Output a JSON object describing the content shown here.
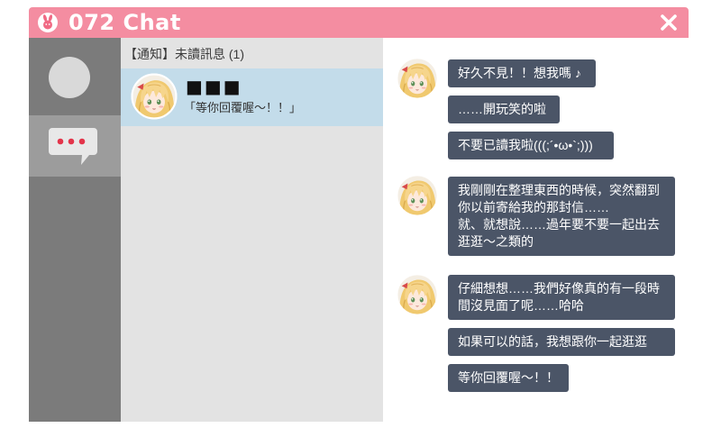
{
  "window": {
    "title": "072 Chat",
    "brand_color": "#f48da1",
    "logo_icon": "app-logo-icon",
    "close_icon": "close-icon"
  },
  "sidebar": {
    "items": [
      {
        "icon": "avatar-placeholder-icon",
        "active": false
      },
      {
        "icon": "chat-bubble-icon",
        "active": true
      }
    ]
  },
  "conversation_list": {
    "header": "【通知】未讀訊息 (1)",
    "items": [
      {
        "contact_name": "■■■",
        "preview": "「等你回覆喔〜！！」",
        "selected": true
      }
    ]
  },
  "chat": {
    "bubble_color": "#4b5567",
    "groups": [
      {
        "messages": [
          {
            "text": "好久不見！！想我嗎 ♪"
          },
          {
            "text": "……開玩笑的啦"
          },
          {
            "text": "不要已讀我啦(((;´•ω•`;)))"
          }
        ]
      },
      {
        "messages": [
          {
            "text": "我剛剛在整理東西的時候，突然翻到\n你以前寄給我的那封信……\n就、就想說……過年要不要一起出去\n逛逛〜之類的"
          }
        ]
      },
      {
        "messages": [
          {
            "text": "仔細想想……我們好像真的有一段時\n間沒見面了呢……哈哈"
          },
          {
            "text": "如果可以的話，我想跟你一起逛逛"
          },
          {
            "text": "等你回覆喔〜！！"
          }
        ]
      }
    ]
  }
}
